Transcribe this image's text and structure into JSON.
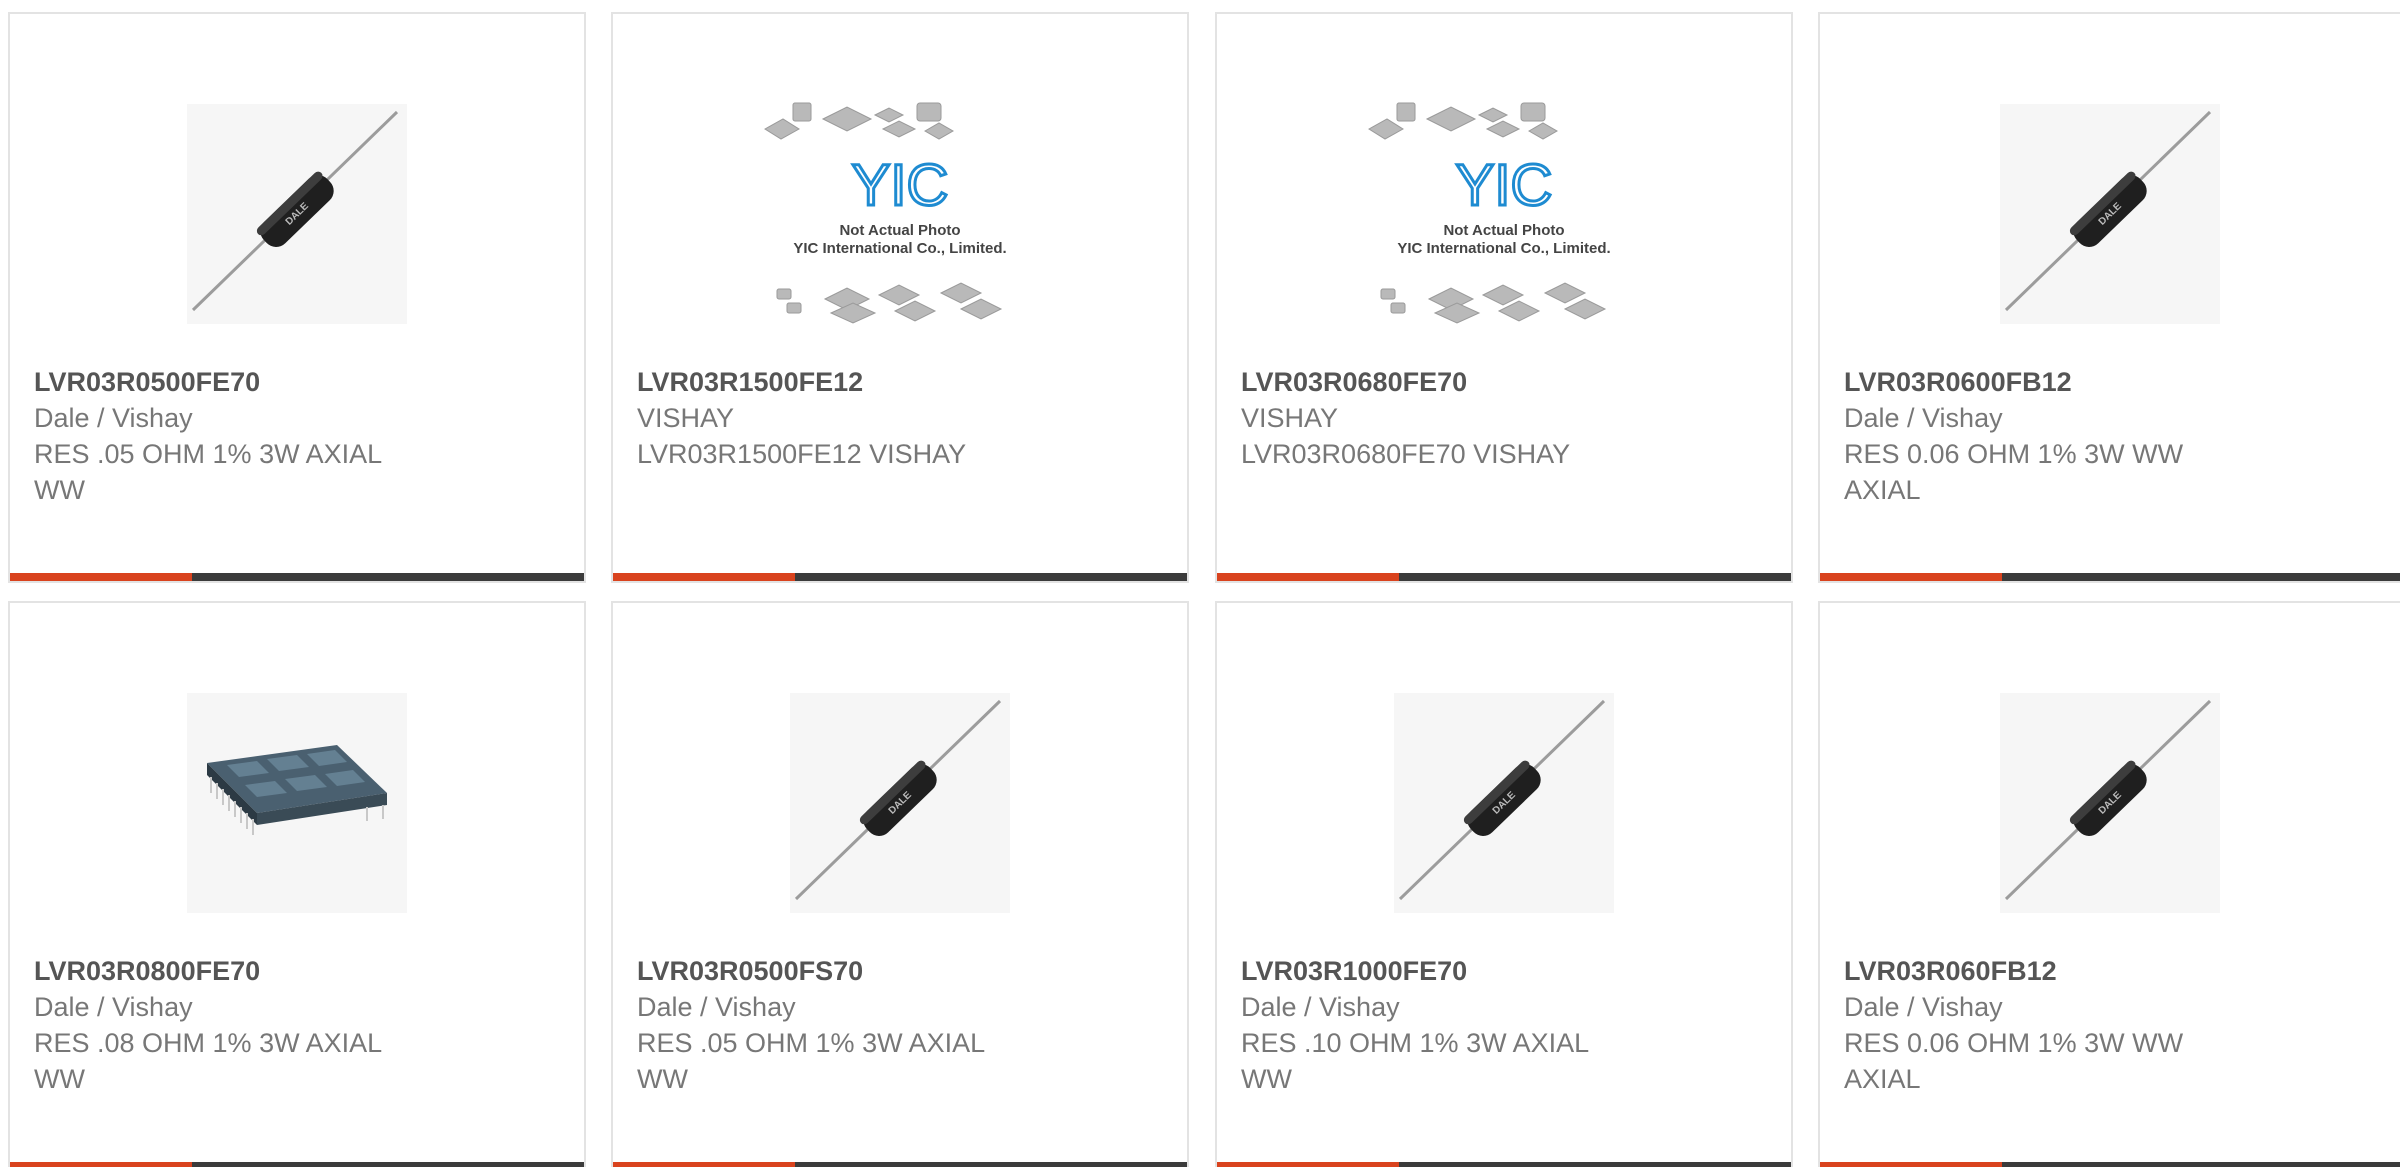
{
  "products": [
    {
      "part": "LVR03R0500FE70",
      "manufacturer": "Dale / Vishay",
      "description": "RES .05 OHM 1% 3W AXIAL WW",
      "image": "axial-resistor-icon",
      "image_marking": "DALE"
    },
    {
      "part": "LVR03R1500FE12",
      "manufacturer": "VISHAY",
      "description": "LVR03R1500FE12 VISHAY",
      "image": "placeholder-photo-icon",
      "placeholder_line1": "Not Actual Photo",
      "placeholder_line2": "YIC International Co., Limited.",
      "placeholder_logo": "YIC"
    },
    {
      "part": "LVR03R0680FE70",
      "manufacturer": "VISHAY",
      "description": "LVR03R0680FE70 VISHAY",
      "image": "placeholder-photo-icon",
      "placeholder_line1": "Not Actual Photo",
      "placeholder_line2": "YIC International Co., Limited.",
      "placeholder_logo": "YIC"
    },
    {
      "part": "LVR03R0600FB12",
      "manufacturer": "Dale / Vishay",
      "description": "RES 0.06 OHM 1% 3W WW AXIAL",
      "image": "axial-resistor-icon",
      "image_marking": "DALE"
    },
    {
      "part": "LVR03R0800FE70",
      "manufacturer": "Dale / Vishay",
      "description": "RES .08 OHM 1% 3W AXIAL WW",
      "image": "ic-chip-icon"
    },
    {
      "part": "LVR03R0500FS70",
      "manufacturer": "Dale / Vishay",
      "description": "RES .05 OHM 1% 3W AXIAL WW",
      "image": "axial-resistor-icon",
      "image_marking": "DALE"
    },
    {
      "part": "LVR03R1000FE70",
      "manufacturer": "Dale / Vishay",
      "description": "RES .10 OHM 1% 3W AXIAL WW",
      "image": "axial-resistor-icon",
      "image_marking": "DALE"
    },
    {
      "part": "LVR03R060FB12",
      "manufacturer": "Dale / Vishay",
      "description": "RES 0.06 OHM 1% 3W WW AXIAL",
      "image": "axial-resistor-icon",
      "image_marking": "DALE"
    }
  ],
  "colors": {
    "accent_orange": "#d9431e",
    "accent_dark": "#3b3b3b",
    "card_border": "#e3e3e3",
    "part_text": "#555555",
    "body_text": "#777777",
    "logo_blue": "#1e8bd1"
  }
}
